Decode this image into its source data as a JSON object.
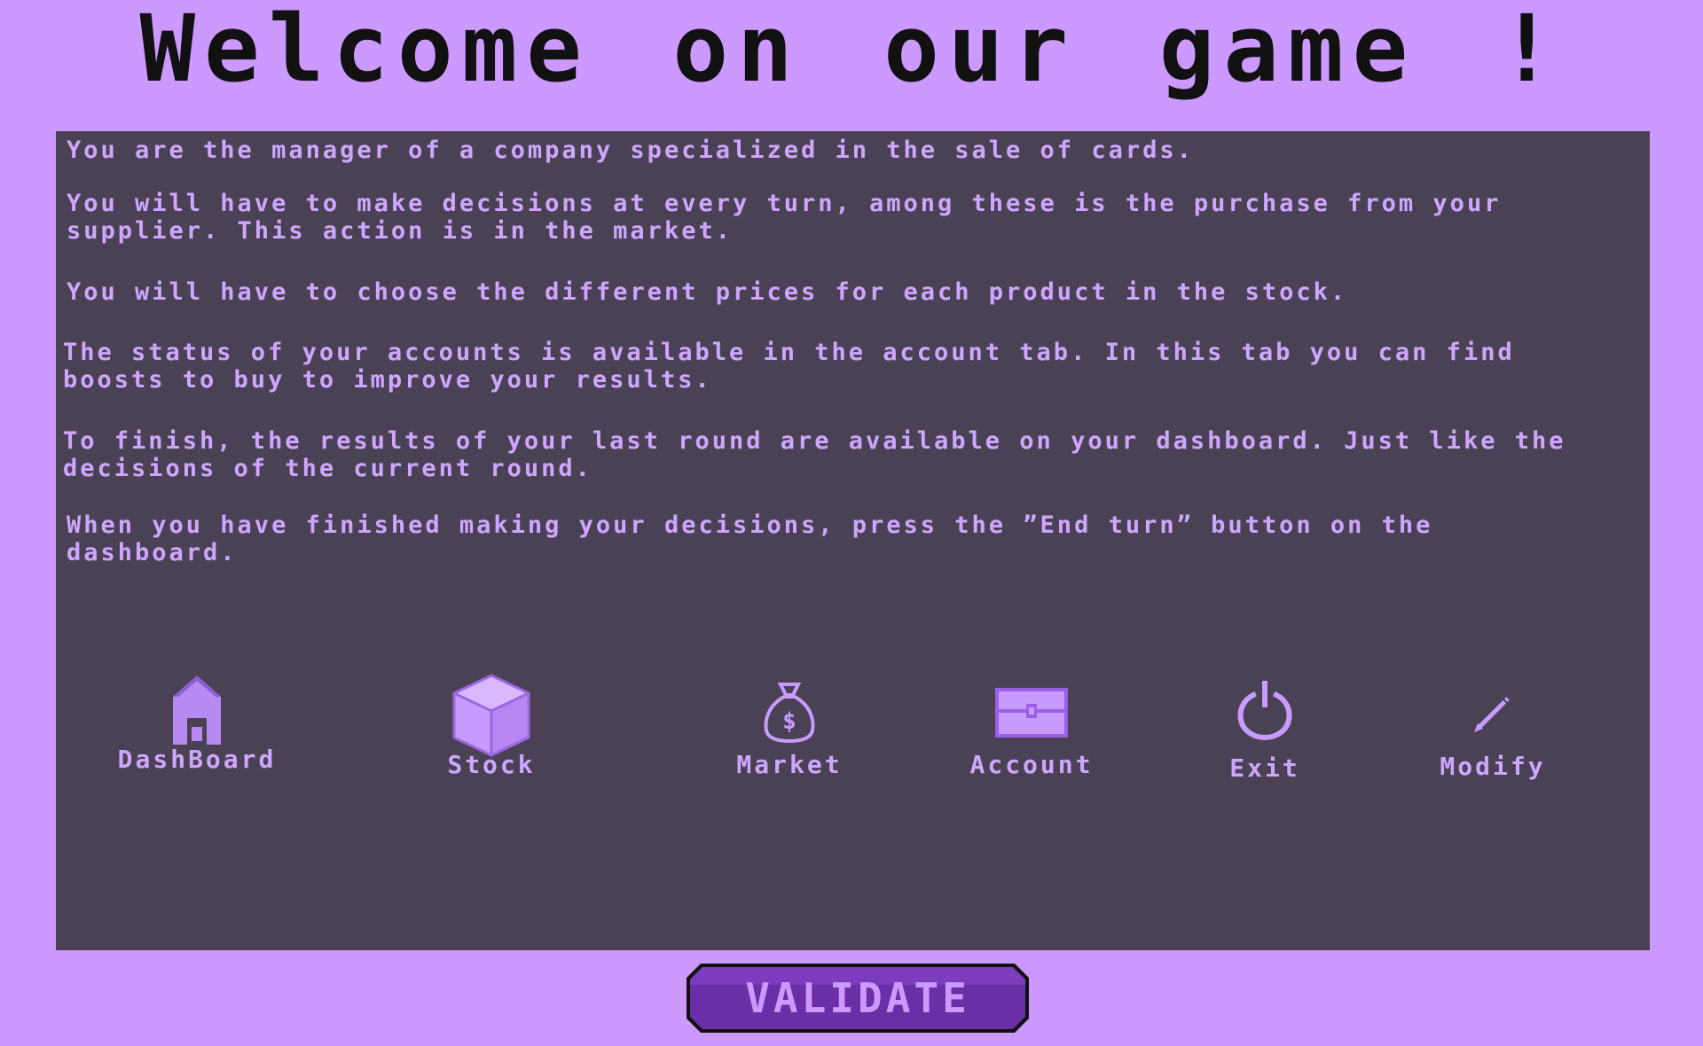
{
  "title": "Welcome on our game !",
  "intro": {
    "p1": "You are the manager of a company specialized in the sale of cards.",
    "p2": "You will have to make decisions at every turn, among these is the purchase from your supplier. This action is in the market.",
    "p3": "You will have to choose the different prices for each product in the stock.",
    "p4": "The status of your accounts is available in the account tab. In this tab you can find boosts to buy to improve your results.",
    "p5": "To finish, the results of your last round are available on your dashboard. Just like the decisions of the current round.",
    "p6": "When you have finished making your decisions, press the ”End turn” button on the dashboard."
  },
  "nav": {
    "dashboard": {
      "label": "DashBoard",
      "icon": "house-icon"
    },
    "stock": {
      "label": "Stock",
      "icon": "box-icon"
    },
    "market": {
      "label": "Market",
      "icon": "money-bag-icon"
    },
    "account": {
      "label": "Account",
      "icon": "chest-icon"
    },
    "exit": {
      "label": "Exit",
      "icon": "power-icon"
    },
    "modify": {
      "label": "Modify",
      "icon": "pencil-icon"
    }
  },
  "validate_label": "VALIDATE",
  "colors": {
    "background": "#cc99ff",
    "panel": "#4a4254",
    "text": "#cfa6ff",
    "button": "#6a2ea6",
    "title": "#111111"
  }
}
